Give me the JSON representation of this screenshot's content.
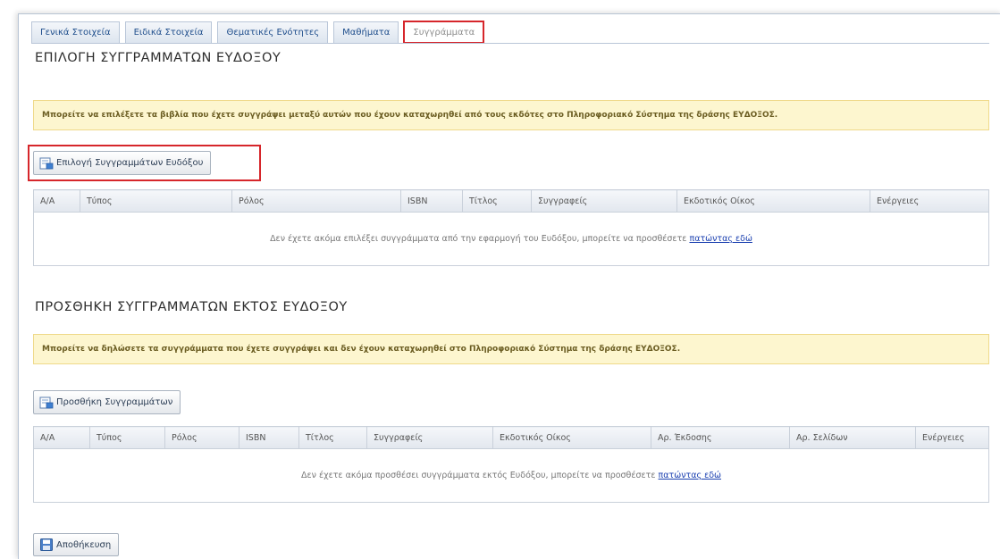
{
  "tabs": [
    {
      "label": "Γενικά Στοιχεία"
    },
    {
      "label": "Ειδικά Στοιχεία"
    },
    {
      "label": "Θεματικές Ενότητες"
    },
    {
      "label": "Μαθήματα"
    },
    {
      "label": "Συγγράμματα"
    }
  ],
  "active_tab": "Συγγράμματα",
  "eudoxus_section": {
    "title": "ΕΠΙΛΟΓΗ ΣΥΓΓΡΑΜΜΑΤΩΝ ΕΥΔΟΞΟΥ",
    "notice": "Μπορείτε να επιλέξετε τα βιβλία που έχετε συγγράψει μεταξύ αυτών που έχουν καταχωρηθεί από τους εκδότες στο Πληροφοριακό Σύστημα της δράσης ΕΥΔΟΞΟΣ.",
    "button_label": "Επιλογή Συγγραμμάτων Ευδόξου",
    "columns": [
      "Α/Α",
      "Τύπος",
      "Ρόλος",
      "ISBN",
      "Τίτλος",
      "Συγγραφείς",
      "Εκδοτικός Οίκος",
      "Ενέργειες"
    ],
    "empty_text": "Δεν έχετε ακόμα επιλέξει συγγράμματα από την εφαρμογή του Ευδόξου, μπορείτε να προσθέσετε",
    "empty_link": "πατώντας εδώ"
  },
  "external_section": {
    "title": "ΠΡΟΣΘΗΚΗ ΣΥΓΓΡΑΜΜΑΤΩΝ ΕΚΤΟΣ ΕΥΔΟΞΟΥ",
    "notice": "Μπορείτε να δηλώσετε τα συγγράμματα που έχετε συγγράψει και δεν έχουν καταχωρηθεί στο Πληροφοριακό Σύστημα της δράσης ΕΥΔΟΞΟΣ.",
    "button_label": "Προσθήκη Συγγραμμάτων",
    "columns": [
      "Α/Α",
      "Τύπος",
      "Ρόλος",
      "ISBN",
      "Τίτλος",
      "Συγγραφείς",
      "Εκδοτικός Οίκος",
      "Αρ. Έκδοσης",
      "Αρ. Σελίδων",
      "Ενέργειες"
    ],
    "empty_text": "Δεν έχετε ακόμα προσθέσει συγγράμματα εκτός Ευδόξου, μπορείτε να προσθέσετε",
    "empty_link": "πατώντας εδώ"
  },
  "save_button_label": "Αποθήκευση",
  "colors": {
    "highlight": "#d6262b",
    "notice_bg": "#fdf6cf",
    "link": "#1a3fb0",
    "tab_text": "#1f4e8c"
  }
}
